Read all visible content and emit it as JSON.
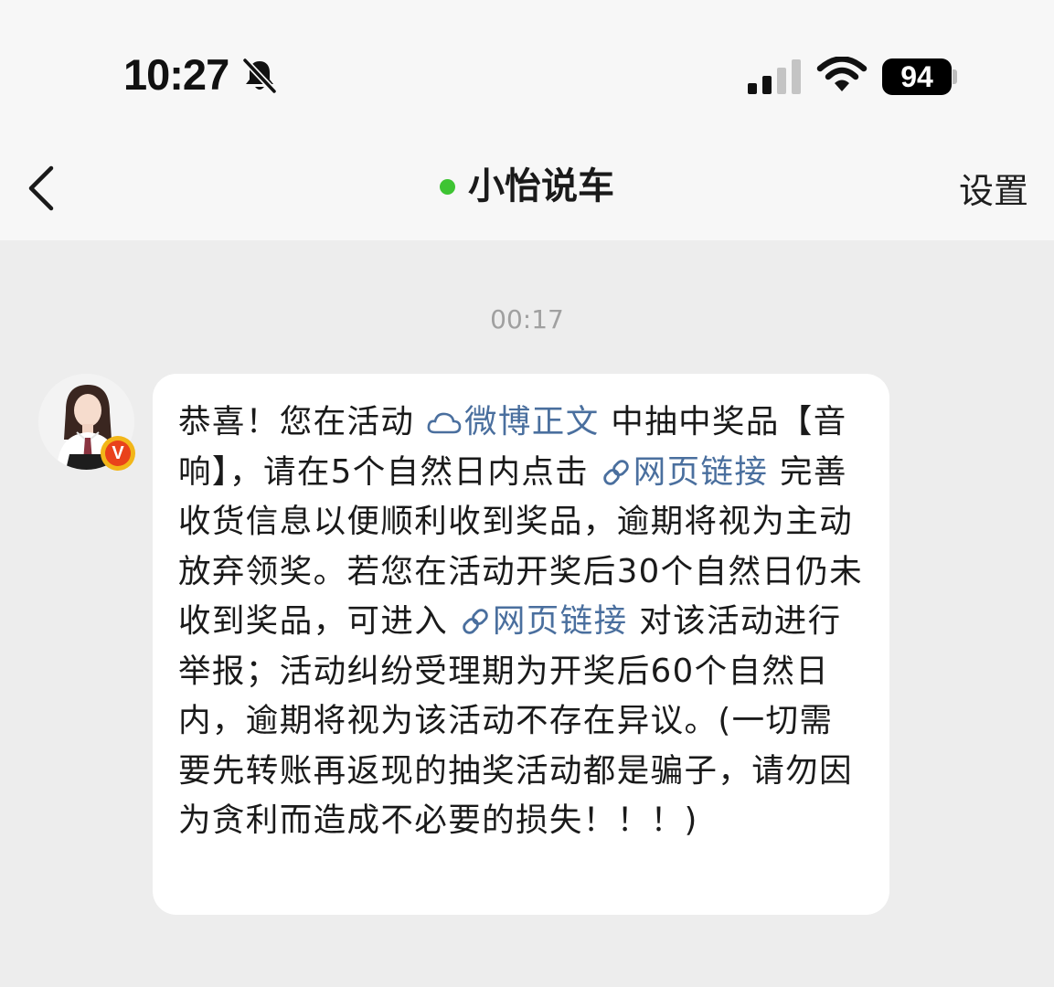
{
  "status_bar": {
    "time": "10:27",
    "battery": "94"
  },
  "nav": {
    "title": "小怡说车",
    "settings_label": "设置"
  },
  "chat": {
    "timestamp": "00:17",
    "message": {
      "p1": "恭喜！您在活动 ",
      "link_weibo": "微博正文",
      "p2": " 中抽中奖品【音响】，请在5个自然日内点击 ",
      "link_web_1": "网页链接",
      "p3": " 完善收货信息以便顺利收到奖品，逾期将视为主动放弃领奖。若您在活动开奖后30个自然日仍未收到奖品，可进入 ",
      "link_web_2": "网页链接",
      "p4": " 对该活动进行举报；活动纠纷受理期为开奖后60个自然日内，逾期将视为该活动不存在异议。(一切需要先转账再返现的抽奖活动都是骗子，请勿因为贪利而造成不必要的损失！！！)"
    }
  },
  "colors": {
    "link": "#4a6f9e",
    "online_dot": "#3ec433",
    "background": "#ededed"
  },
  "icons": {
    "silent": "bell-slash-icon",
    "signal": "cellular-signal-icon",
    "wifi": "wifi-icon",
    "back": "chevron-left-icon",
    "weibo_link": "cloud-icon",
    "web_link": "link-icon",
    "verified": "verified-v-badge-icon"
  }
}
